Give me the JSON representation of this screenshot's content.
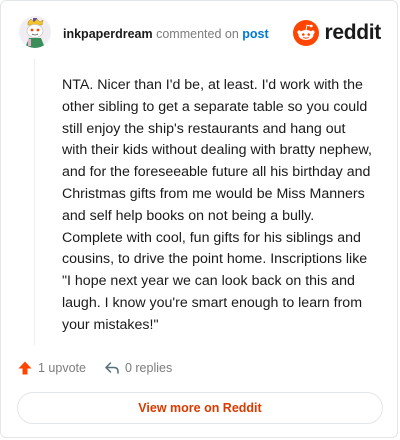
{
  "comment": {
    "author": "inkpaperdream",
    "action_text": "commented on",
    "post_link": "post",
    "body": "NTA. Nicer than I'd be, at least. I'd work with the other sibling to get a separate table so you could still enjoy the ship's restaurants and hang out with their kids without dealing with bratty nephew, and for the foreseeable future all his birthday and Christmas gifts from me would be Miss Manners and self help books on not being a bully. Complete with cool, fun gifts for his siblings and cousins, to drive the point home. Inscriptions like \"I hope next year we can look back on this and laugh. I know you're smart enough to learn from your mistakes!\"",
    "upvotes": "1 upvote",
    "replies": "0 replies"
  },
  "brand": {
    "wordmark": "reddit",
    "color": "#ff4500"
  },
  "cta": {
    "label": "View more on Reddit",
    "color": "#d93a00"
  },
  "icons": {
    "avatar": "snoo-avatar",
    "brand": "reddit-logo-icon",
    "upvote": "upvote-arrow-icon",
    "reply": "reply-arrow-icon"
  }
}
